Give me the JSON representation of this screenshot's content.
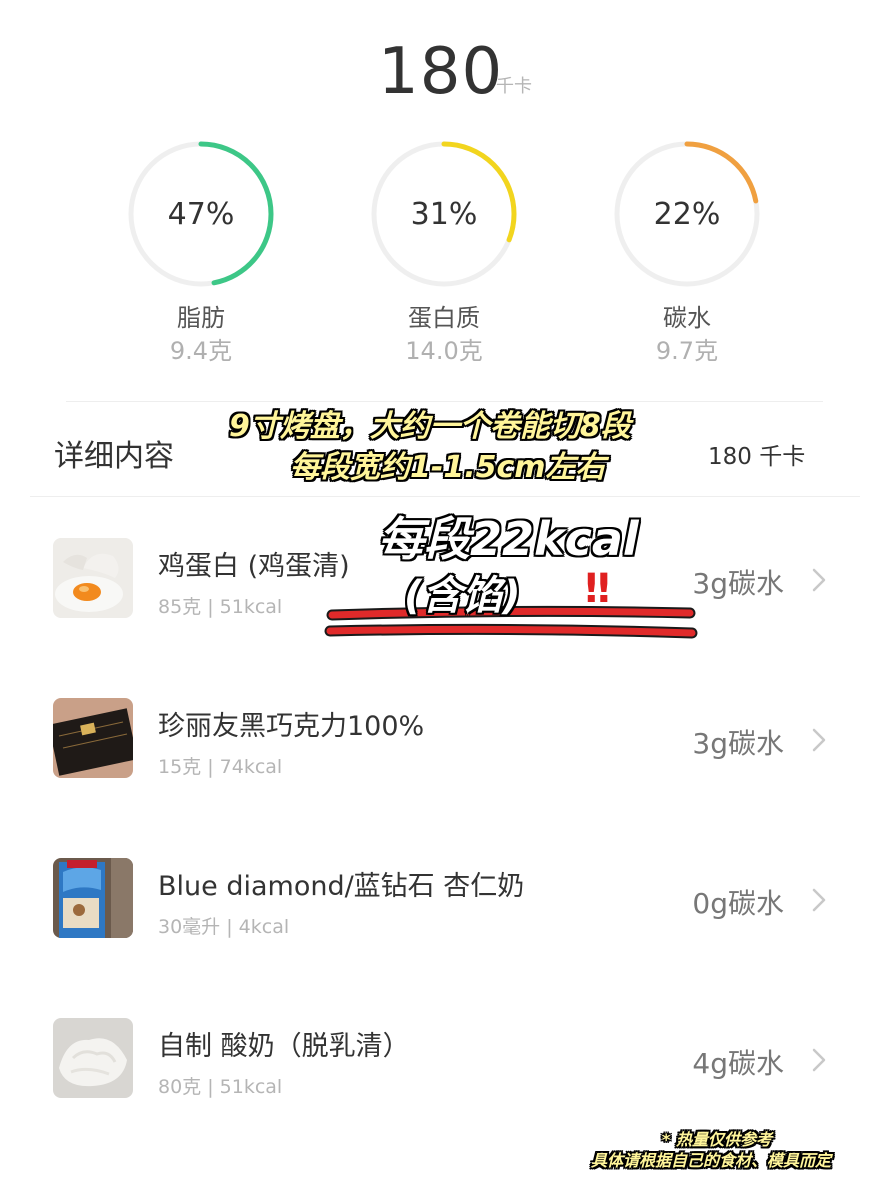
{
  "summary": {
    "total_value": "180",
    "total_unit": "千卡"
  },
  "macros": [
    {
      "pct_label": "47%",
      "pct": 0.47,
      "name": "脂肪",
      "amount": "9.4克",
      "color": "#3dc787"
    },
    {
      "pct_label": "31%",
      "pct": 0.31,
      "name": "蛋白质",
      "amount": "14.0克",
      "color": "#f2d51e"
    },
    {
      "pct_label": "22%",
      "pct": 0.22,
      "name": "碳水",
      "amount": "9.7克",
      "color": "#f0a040"
    }
  ],
  "detail": {
    "title": "详细内容",
    "total": "180 千卡"
  },
  "foods": [
    {
      "name": "鸡蛋白 (鸡蛋清)",
      "sub": "85克 | 51kcal",
      "carb": "3g碳水",
      "thumb_icon": "egg-white-photo"
    },
    {
      "name": "珍丽友黑巧克力100%",
      "sub": "15克 | 74kcal",
      "carb": "3g碳水",
      "thumb_icon": "dark-chocolate-photo"
    },
    {
      "name": "Blue diamond/蓝钻石 杏仁奶",
      "sub": "30毫升 | 4kcal",
      "carb": "0g碳水",
      "thumb_icon": "almond-milk-photo"
    },
    {
      "name": "自制 酸奶（脱乳清）",
      "sub": "80克 | 51kcal",
      "carb": "4g碳水",
      "thumb_icon": "yogurt-photo"
    }
  ],
  "overlay": {
    "line1": "9寸烤盘，大约一个卷能切8段",
    "line2": "每段宽约1-1.5cm左右",
    "line3": "每段22kcal",
    "line4": "(含馅)",
    "exclaim": "‼",
    "note1": "* 热量仅供参考",
    "note2": "具体请根据自己的食材、模具而定"
  },
  "colors": {
    "ring_track": "#efefef",
    "underline_red": "#e02a2a"
  }
}
